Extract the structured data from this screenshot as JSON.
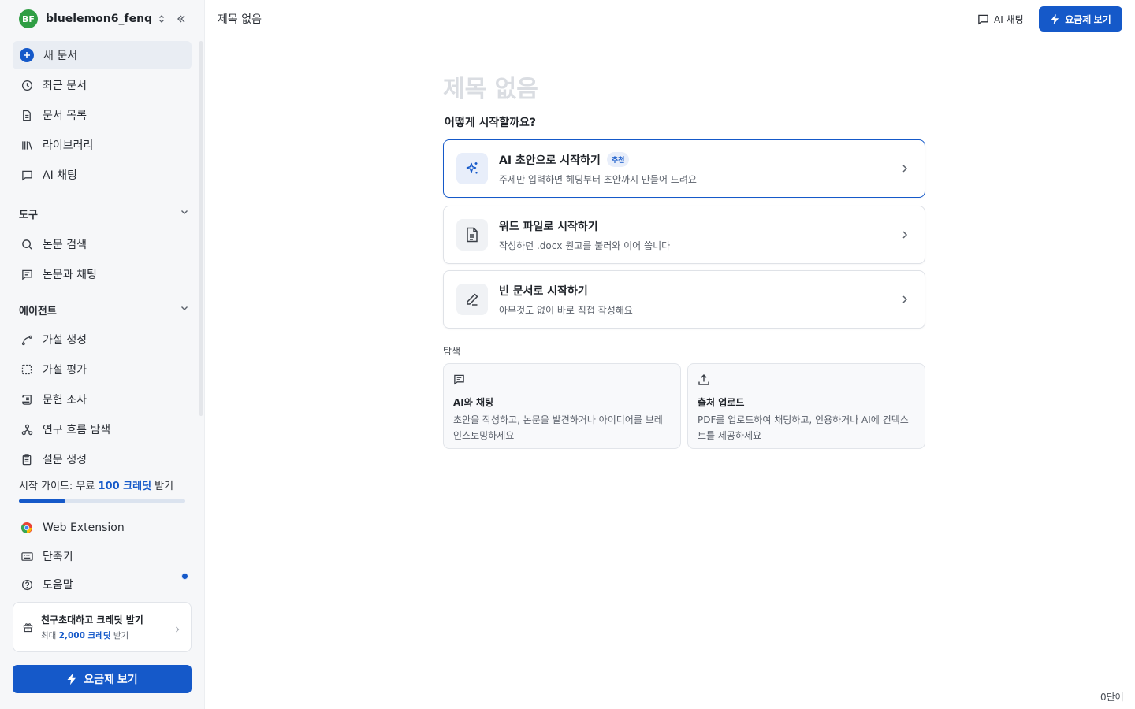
{
  "sidebar": {
    "user": {
      "initials": "BF",
      "name": "bluelemon6_fenq"
    },
    "nav": [
      {
        "label": "새 문서",
        "icon": "plus-circle-icon"
      },
      {
        "label": "최근 문서",
        "icon": "clock-icon"
      },
      {
        "label": "문서 목록",
        "icon": "document-icon"
      },
      {
        "label": "라이브러리",
        "icon": "library-icon"
      },
      {
        "label": "AI 채팅",
        "icon": "chat-icon"
      }
    ],
    "tools_header": "도구",
    "tools": [
      {
        "label": "논문 검색",
        "icon": "search-icon"
      },
      {
        "label": "논문과 채팅",
        "icon": "paper-chat-icon"
      }
    ],
    "agents_header": "에이전트",
    "agents": [
      {
        "label": "가설 생성",
        "icon": "branch-icon"
      },
      {
        "label": "가설 평가",
        "icon": "dashed-square-icon"
      },
      {
        "label": "문헌 조사",
        "icon": "scroll-icon"
      },
      {
        "label": "연구 흐름 탐색",
        "icon": "network-icon"
      },
      {
        "label": "설문 생성",
        "icon": "clipboard-icon"
      }
    ],
    "guide": {
      "prefix": "시작 가이드: 무료 ",
      "highlight": "100 크레딧",
      "suffix": " 받기",
      "progress": 0.28
    },
    "bottom": [
      {
        "label": "Web Extension",
        "icon": "chrome-icon"
      },
      {
        "label": "단축키",
        "icon": "keyboard-icon"
      },
      {
        "label": "도움말",
        "icon": "help-icon"
      }
    ],
    "invite": {
      "title": "친구초대하고 크레딧 받기",
      "sub_prefix": "최대 ",
      "sub_highlight": "2,000 크레딧",
      "sub_suffix": " 받기"
    },
    "pricing_label": "요금제 보기"
  },
  "topbar": {
    "doc_title": "제목 없음",
    "chat_label": "AI 채팅",
    "pricing_label": "요금제 보기"
  },
  "main": {
    "title_placeholder": "제목 없음",
    "question": "어떻게 시작할까요?",
    "options": [
      {
        "title": "AI 초안으로 시작하기",
        "badge": "추천",
        "desc": "주제만 입력하면 헤딩부터 초안까지 만들어 드려요",
        "icon": "sparkle-icon"
      },
      {
        "title": "워드 파일로 시작하기",
        "desc": "작성하던 .docx 원고를 불러와 이어 씁니다",
        "icon": "file-text-icon"
      },
      {
        "title": "빈 문서로 시작하기",
        "desc": "아무것도 없이 바로 직접 작성해요",
        "icon": "pencil-icon"
      }
    ],
    "explore_label": "탐색",
    "explore": [
      {
        "title": "AI와 채팅",
        "desc": "초안을 작성하고, 논문을 발견하거나 아이디어를 브레인스토밍하세요",
        "icon": "message-icon"
      },
      {
        "title": "출처 업로드",
        "desc": "PDF를 업로드하여 채팅하고, 인용하거나 AI에 컨텍스트를 제공하세요",
        "icon": "upload-icon"
      }
    ]
  },
  "footer": {
    "word_count": "0단어"
  },
  "colors": {
    "accent": "#1559c9",
    "sidebar_bg": "#f6f7f9",
    "avatar": "#2f9e44"
  }
}
